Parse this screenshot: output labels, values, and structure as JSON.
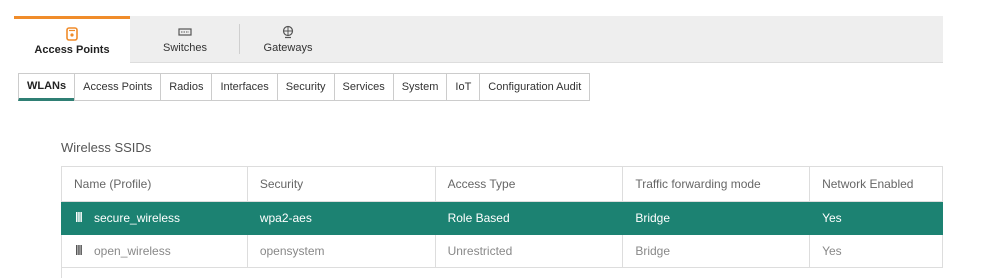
{
  "device_tabs": [
    {
      "label": "Access Points",
      "icon": "access-point-icon",
      "active": true
    },
    {
      "label": "Switches",
      "icon": "switch-icon",
      "active": false
    },
    {
      "label": "Gateways",
      "icon": "gateway-icon",
      "active": false
    }
  ],
  "subtabs": [
    {
      "label": "WLANs",
      "active": true
    },
    {
      "label": "Access Points",
      "active": false
    },
    {
      "label": "Radios",
      "active": false
    },
    {
      "label": "Interfaces",
      "active": false
    },
    {
      "label": "Security",
      "active": false
    },
    {
      "label": "Services",
      "active": false
    },
    {
      "label": "System",
      "active": false
    },
    {
      "label": "IoT",
      "active": false
    },
    {
      "label": "Configuration Audit",
      "active": false
    }
  ],
  "section_title": "Wireless SSIDs",
  "table": {
    "headers": [
      "Name (Profile)",
      "Security",
      "Access Type",
      "Traffic forwarding mode",
      "Network Enabled"
    ],
    "rows": [
      {
        "name": "secure_wireless",
        "security": "wpa2-aes",
        "access_type": "Role Based",
        "forwarding": "Bridge",
        "enabled": "Yes",
        "selected": true
      },
      {
        "name": "open_wireless",
        "security": "opensystem",
        "access_type": "Unrestricted",
        "forwarding": "Bridge",
        "enabled": "Yes",
        "selected": false
      }
    ]
  },
  "colors": {
    "accent_orange": "#f08c2a",
    "selected_row": "#1c8272"
  }
}
